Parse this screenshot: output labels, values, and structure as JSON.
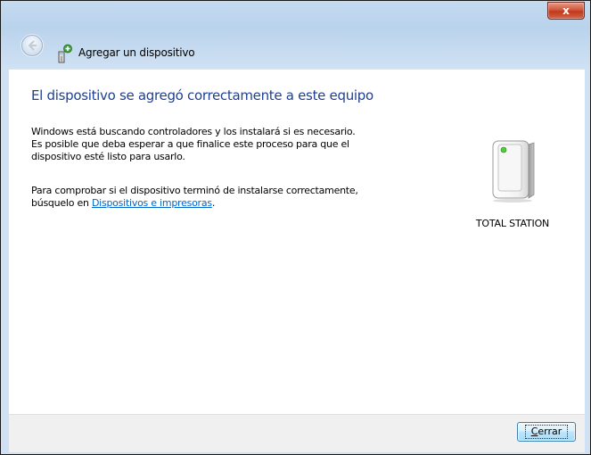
{
  "window": {
    "close_glyph": "x",
    "close_icon": "close-icon"
  },
  "nav": {
    "back_icon": "back-arrow-icon",
    "wizard_icon": "add-device-icon",
    "title": "Agregar un dispositivo"
  },
  "main": {
    "heading": "El dispositivo se agregó correctamente a este equipo",
    "para1": [
      "Windows está buscando controladores y los instalará si es necesario.",
      "Es posible que deba esperar a que finalice este proceso para que el",
      "dispositivo esté listo para usarlo."
    ],
    "para2_line1": "Para comprobar si el dispositivo terminó de instalarse correctamente,",
    "para2_line2_prefix": "búsquelo en ",
    "para2_link": "Dispositivos e impresoras",
    "para2_line2_suffix": "."
  },
  "device": {
    "icon": "device-tower-icon",
    "name": "TOTAL STATION"
  },
  "footer": {
    "close_button_mnemonic": "C",
    "close_button_rest": "errar"
  },
  "colors": {
    "heading": "#1e3f93",
    "link": "#0066cc",
    "close_red": "#c0391c"
  }
}
